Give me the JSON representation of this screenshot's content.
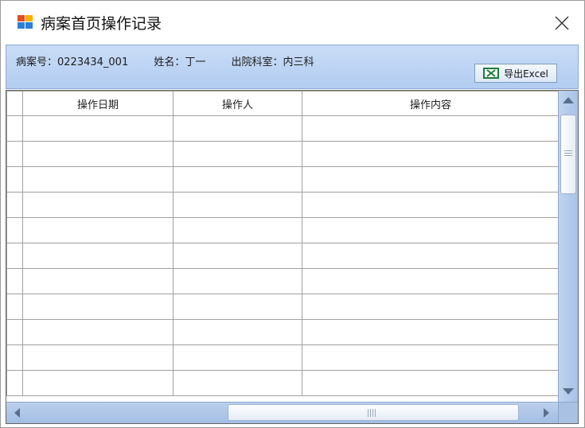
{
  "window": {
    "title": "病案首页操作记录",
    "icon": "app-icon",
    "close_icon": "close-icon"
  },
  "info": {
    "case_no": "病案号：0223434_001",
    "name": "姓名：丁一",
    "dept": "出院科室：内三科"
  },
  "toolbar": {
    "export_label": "导出Excel",
    "export_icon": "excel-icon"
  },
  "grid": {
    "columns": [
      "操作日期",
      "操作人",
      "操作内容"
    ],
    "rows": [
      [
        "",
        "",
        ""
      ],
      [
        "",
        "",
        ""
      ],
      [
        "",
        "",
        ""
      ],
      [
        "",
        "",
        ""
      ],
      [
        "",
        "",
        ""
      ],
      [
        "",
        "",
        ""
      ],
      [
        "",
        "",
        ""
      ],
      [
        "",
        "",
        ""
      ],
      [
        "",
        "",
        ""
      ],
      [
        "",
        "",
        ""
      ],
      [
        "",
        "",
        ""
      ]
    ]
  },
  "colors": {
    "infobar": "#c9dcf6",
    "scrollbar": "#a8c2e6",
    "grid_line": "#a0a0a0"
  }
}
